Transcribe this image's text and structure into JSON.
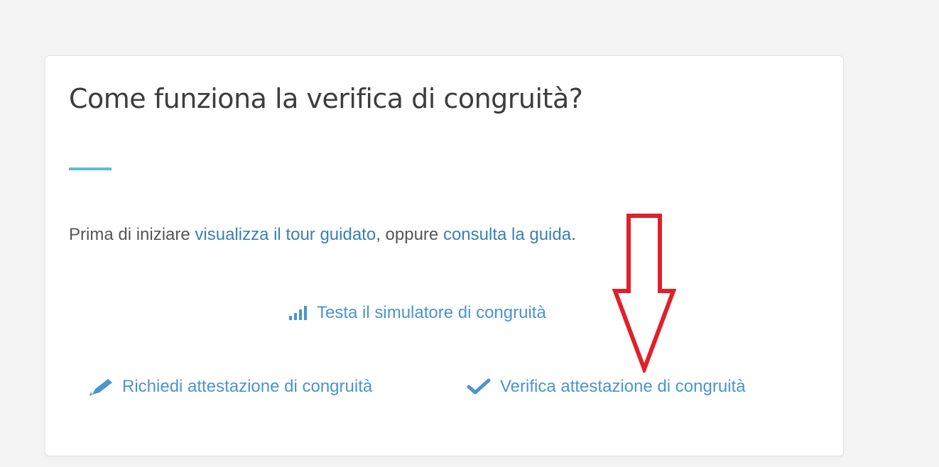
{
  "card": {
    "title": "Come funziona la verifica di congruità?",
    "intro": {
      "prefix": "Prima di iniziare ",
      "tour_link": "visualizza il tour guidato",
      "middle": ", oppure ",
      "guide_link": "consulta la guida",
      "suffix": "."
    },
    "actions": {
      "simulator": {
        "label": "Testa il simulatore di congruità",
        "icon": "signal-bars-icon"
      },
      "request": {
        "label": "Richiedi attestazione di congruità",
        "icon": "pencil-icon"
      },
      "verify": {
        "label": "Verifica attestazione di congruità",
        "icon": "checkmark-icon"
      }
    }
  },
  "colors": {
    "accent": "#5bbcd8",
    "link": "#3a80b5",
    "action": "#4a94d2",
    "annotation_arrow": "#e0202a"
  }
}
